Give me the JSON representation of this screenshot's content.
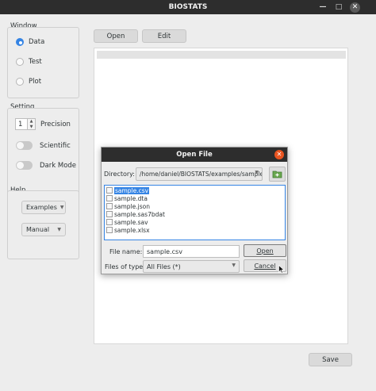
{
  "window": {
    "title": "BIOSTATS"
  },
  "sidebar": {
    "window_group": {
      "label": "Window",
      "options": [
        {
          "label": "Data",
          "checked": true
        },
        {
          "label": "Test",
          "checked": false
        },
        {
          "label": "Plot",
          "checked": false
        }
      ]
    },
    "setting_group": {
      "label": "Setting",
      "precision": {
        "value": "1",
        "label": "Precision"
      },
      "toggles": [
        {
          "label": "Scientific",
          "on": false
        },
        {
          "label": "Dark Mode",
          "on": false
        }
      ]
    },
    "help_group": {
      "label": "Help",
      "examples_label": "Examples",
      "manual_label": "Manual"
    }
  },
  "toolbar": {
    "open_label": "Open",
    "edit_label": "Edit"
  },
  "footer": {
    "save_label": "Save"
  },
  "dialog": {
    "title": "Open File",
    "directory_label": "Directory:",
    "directory_value": "/home/daniel/BIOSTATS/examples/sample",
    "files": [
      "sample.csv",
      "sample.dta",
      "sample.json",
      "sample.sas7bdat",
      "sample.sav",
      "sample.xlsx"
    ],
    "selected_file": "sample.csv",
    "file_name_label": "File name:",
    "file_name_value": "sample.csv",
    "files_of_type_label": "Files of type:",
    "files_of_type_value": "All Files (*)",
    "open_label": "Open",
    "cancel_label": "Cancel"
  },
  "colors": {
    "accent": "#3584e4",
    "titlebar": "#2d2d2d",
    "dialog_close": "#e95420"
  }
}
